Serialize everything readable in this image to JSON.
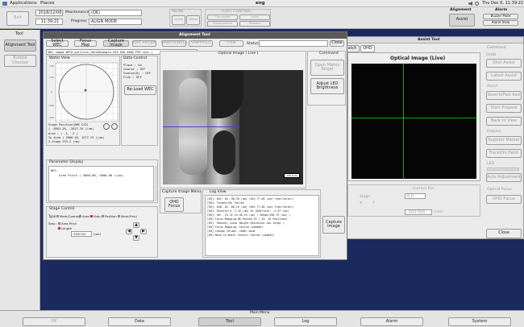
{
  "topbar": {
    "apps": "Applications",
    "places": "Places",
    "window": "eng",
    "clock": "Thu Dec  6, 11:39:22"
  },
  "header": {
    "exit": "Exit",
    "date": "2018/12/06",
    "time": "11:39:21",
    "maint_label": "Maintenance",
    "maint_value": "(OK)",
    "progress_label": "Progress",
    "progress_value": "ALIGN MODE",
    "inline_title": "INLINE",
    "inline_b1": "Online",
    "inline_b2": "Offline",
    "host_title": "HOST CONTROL",
    "host_b1": "Connected",
    "host_b2": "Disconnected",
    "host_b3": "Local",
    "host_b4": "Remote",
    "align_title": "Alignment",
    "align_btn": "Assist",
    "alarm_title": "Alarm",
    "alarm_b1": "Buzzer Mute",
    "alarm_b2": "Alarm View"
  },
  "tool": {
    "title": "Tool",
    "b1": "Alignment Tool",
    "b2": "Bubble Checker"
  },
  "at": {
    "title": "Alignment Tool",
    "toolbar": [
      "Select WEC",
      "Focus Map",
      "Capture Image",
      "Edit Recipe",
      "Search(WEC)",
      "Search(D)",
      "Flow"
    ],
    "status_label": "Status",
    "close": "Close",
    "file": "WEC named WPCO_multirun_102165sample-525-656-5082-FRP-test )",
    "wafer_view": "Wafer View",
    "x_ticks": [
      "-150",
      "-100",
      "-50",
      "0",
      "50",
      "100",
      "150"
    ],
    "stage_pos": "Stage Position(RMS CCD)",
    "stage_xy": "( -8981.26, -2027.29 )(um)",
    "area": "Area : ( -1, -2 )",
    "in_area": "In Area ( 3900.46, 1577.79 )(um)",
    "zstage": "Z-Stage 253.2 (um)",
    "data_control": "Data Control",
    "dc_lines": [
      "Place     : On",
      "Coarse    : OFF",
      "Coarse(D) : OFF",
      "Fine      : OFF"
    ],
    "reload": "Re-Load WEC",
    "param_title": "Parameter Display",
    "param_wec": "WEC:",
    "param_pitch": "Area Pitch ( 3000.00, 3000.00 )(um)",
    "stage_control": "Stage Control",
    "stage_type": "Type",
    "radios": [
      "Mark(Coarse)",
      "Area",
      "Step",
      "Position",
      "Mark(Fine)"
    ],
    "step": "Step :",
    "area_pitch": "Area Pitch",
    "length": "Length",
    "length_val": "3000.00",
    "um": "(um)",
    "optical_title": "Optical Image ( Live )",
    "scale": "100.0um",
    "command": "Command",
    "open_matrix": "Open Matrix Target",
    "adjust_led": "Adjust LED Brightness",
    "capture_menu": "Capture Image Menu",
    "ohd_focus": "OHD Focus",
    "log_title": "Log View",
    "log_lines": [
      "[09]:      #47: 0n    -90.39 (um) (0th   77.05 (um) from Center)",
      "[09]:      Target(49) Failed",
      "[09]:      #48: 0n    -80.19 (um) (0th   77.00 (um) from Center)",
      "[09]:      DCenter(x: 2.44 (um) at [Ddelta(h: -4.37 (um)",
      "[09]:      dH: -33.32 to 56.29 (um) ( Range:356.75 (um) )",
      "[09] Focus Mapping:OK    Passed 25 / 49, 49 Positions",
      "[09]:      Reason) Local Height Deviation too large )",
      "[09] Focus Mapping: Failed (code#4)",
      "[09] Change Column ->OHD: Done",
      "[09] Move to Wafer Center) Failed (code#1)"
    ],
    "capture_image": "Capture Image"
  },
  "assist": {
    "title": "Assist Tool",
    "tab_watch": "atch",
    "tab_ohd": "OHD",
    "image_title": "Optical Image (Live)",
    "command": "Command",
    "side_buttons": [
      "Grab",
      "Shot Assist",
      "Latest Assist",
      "Assist",
      "Search(Fast Assi",
      "Start Prepare",
      "Back to View",
      "Prepare",
      "Register Marker",
      "Track(On Field)",
      "LED",
      "Auto Adjustment",
      "Optical Focus",
      "OHD Focus"
    ],
    "stage": "Stage",
    "x": "X",
    "y": "Y",
    "current_pos": "Current Pos",
    "close": "Close",
    "led_val": "0.0",
    "pos_val": "-502.500",
    "unit": "(um)"
  },
  "menu": {
    "title": "Main Menu",
    "items": [
      "OK",
      "Data",
      "Tool",
      "Log",
      "Alarm",
      "System"
    ]
  }
}
